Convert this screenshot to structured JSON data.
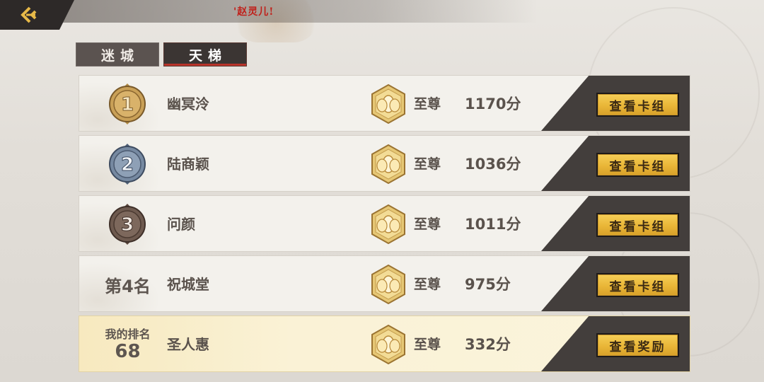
{
  "header": {
    "marquee_text": "'赵灵儿!"
  },
  "tabs": [
    {
      "label": "迷城",
      "active": false
    },
    {
      "label": "天梯",
      "active": true
    }
  ],
  "rows": [
    {
      "rank_medal": 1,
      "rank_text": "1",
      "name": "幽冥泠",
      "tier": "至尊",
      "score": "1170分",
      "button": "查看卡组"
    },
    {
      "rank_medal": 2,
      "rank_text": "2",
      "name": "陆商颖",
      "tier": "至尊",
      "score": "1036分",
      "button": "查看卡组"
    },
    {
      "rank_medal": 3,
      "rank_text": "3",
      "name": "问颜",
      "tier": "至尊",
      "score": "1011分",
      "button": "查看卡组"
    },
    {
      "rank_label": "第4名",
      "name": "祝城堂",
      "tier": "至尊",
      "score": "975分",
      "button": "查看卡组"
    }
  ],
  "my_row": {
    "rank_label": "我的排名",
    "rank_value": "68",
    "name": "圣人惠",
    "tier": "至尊",
    "score": "332分",
    "button": "查看奖励"
  },
  "colors": {
    "medal_gold": "#b88a3a",
    "medal_silver": "#6e7f95",
    "medal_bronze": "#6b5548",
    "button_gold": "#e9b637",
    "active_tab_accent": "#b8332a"
  },
  "icons": {
    "back": "back-arrow-icon",
    "tier": "supreme-tier-icon"
  }
}
